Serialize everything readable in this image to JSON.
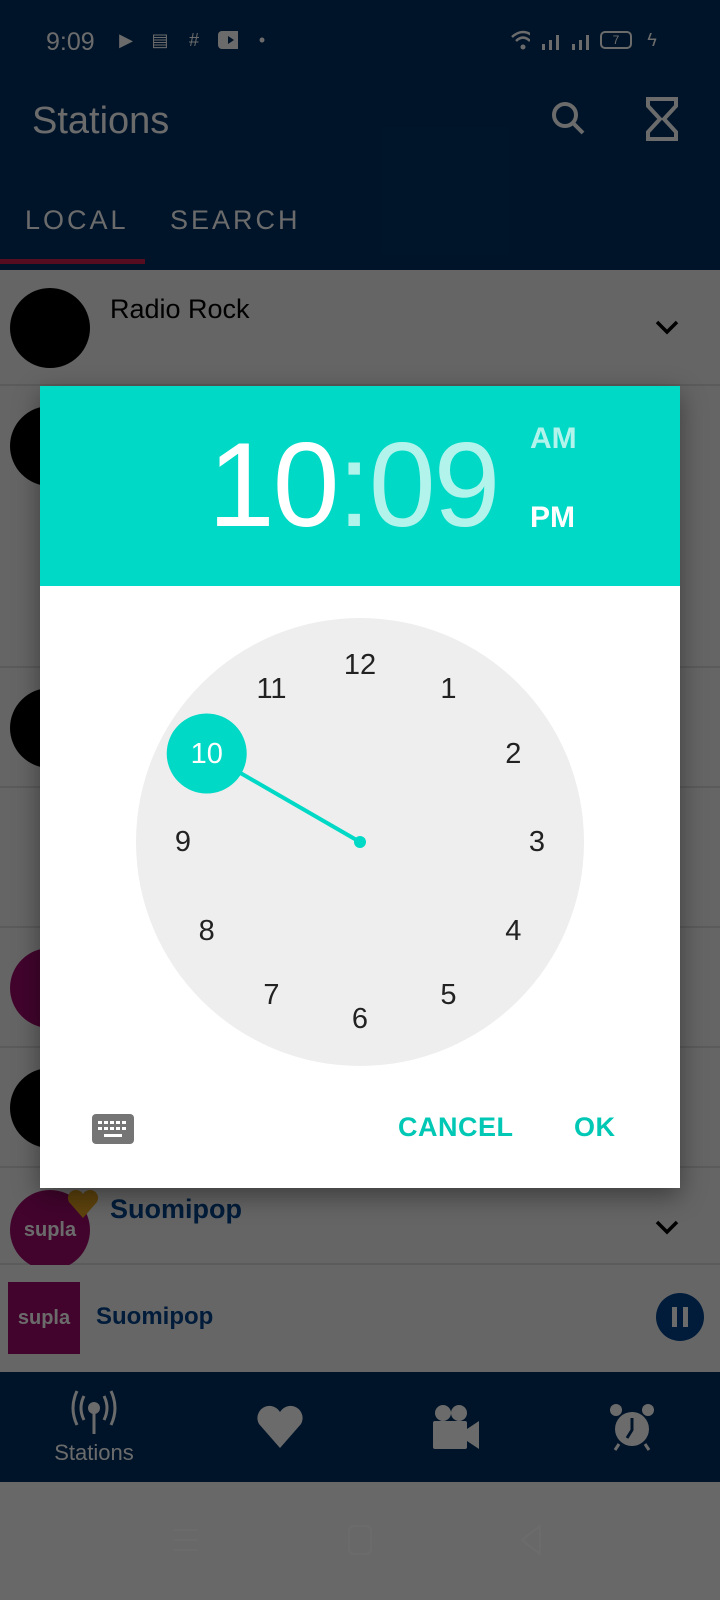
{
  "status_bar": {
    "time": "9:09",
    "left_icons": [
      "play-icon",
      "notes-icon",
      "slack-icon",
      "youtube-icon",
      "dot-icon"
    ],
    "right_icons": [
      "wifi-icon",
      "signal-icon",
      "signal-icon",
      "battery-icon",
      "charging-icon"
    ],
    "battery_level": "7"
  },
  "app_bar": {
    "title": "Stations",
    "actions": [
      "search-icon",
      "hourglass-icon"
    ]
  },
  "tabs": [
    {
      "label": "LOCAL",
      "active": true
    },
    {
      "label": "SEARCH",
      "active": false
    }
  ],
  "stations": [
    {
      "name": "Radio Rock"
    },
    {
      "name": "Suomipop",
      "favorite": true,
      "logo_text": "supla"
    }
  ],
  "player": {
    "station": "Suomipop",
    "logo_text": "supla",
    "state": "playing"
  },
  "bottom_nav": [
    {
      "label": "Stations",
      "icon": "radio-tower-icon",
      "active": true
    },
    {
      "label": "",
      "icon": "heart-icon"
    },
    {
      "label": "",
      "icon": "video-camera-icon"
    },
    {
      "label": "",
      "icon": "alarm-clock-icon"
    }
  ],
  "time_picker": {
    "hour": "10",
    "separator": ":",
    "minute": "09",
    "am_label": "AM",
    "pm_label": "PM",
    "selected_period": "PM",
    "selected_hour": 10,
    "clock_numbers": [
      "12",
      "1",
      "2",
      "3",
      "4",
      "5",
      "6",
      "7",
      "8",
      "9",
      "10",
      "11"
    ],
    "cancel_label": "CANCEL",
    "ok_label": "OK",
    "accent_color": "#00d9c5",
    "button_color": "#00c8b4"
  },
  "colors": {
    "primary": "#003063",
    "tab_indicator": "#cc1f4a",
    "player_text": "#00448a"
  }
}
